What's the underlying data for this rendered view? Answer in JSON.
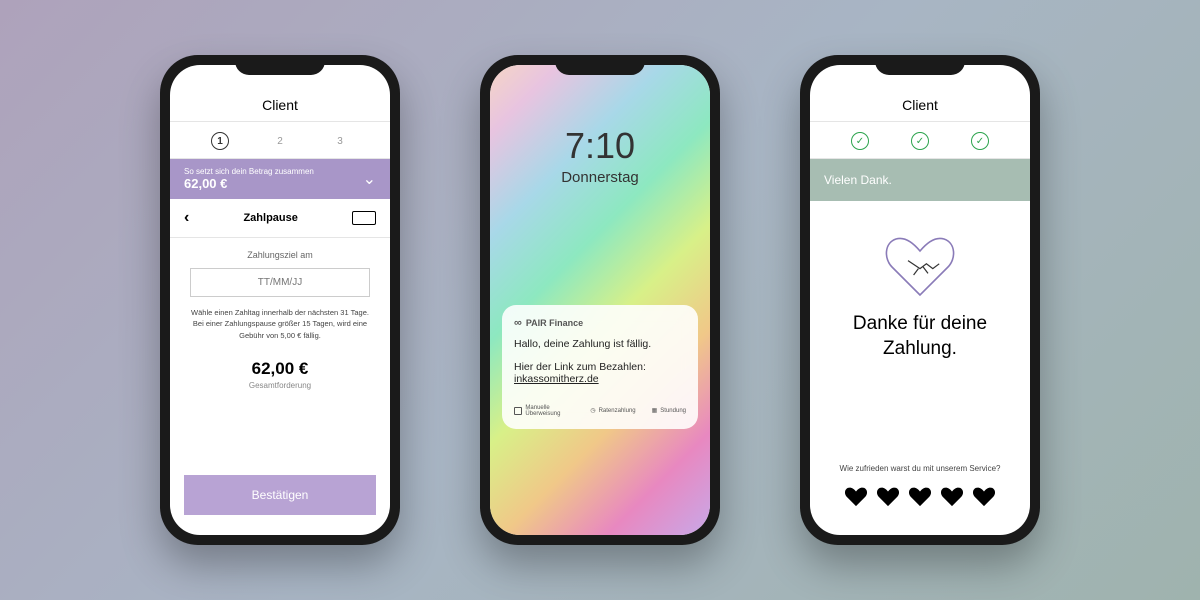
{
  "phone1": {
    "title": "Client",
    "steps": [
      "1",
      "2",
      "3"
    ],
    "amountBand": {
      "label": "So setzt sich dein Betrag zusammen",
      "amount": "62,00 €"
    },
    "zahlpause": "Zahlpause",
    "dateLabel": "Zahlungsziel am",
    "datePlaceholder": "TT/MM/JJ",
    "helpText": "Wähle einen Zahltag innerhalb der nächsten 31 Tage. Bei einer Zahlungspause größer 15 Tagen, wird eine Gebühr von 5,00 € fällig.",
    "total": "62,00 €",
    "totalLabel": "Gesamtforderung",
    "confirm": "Bestätigen"
  },
  "phone2": {
    "time": "7:10",
    "day": "Donnerstag",
    "notifSender": "PAIR Finance",
    "notifGreeting": "Hallo, deine Zahlung ist fällig.",
    "notifLinkLabel": "Hier der Link zum Bezahlen:",
    "notifLink": "inkassomitherz.de",
    "pills": [
      "Manuelle Überweisung",
      "Ratenzahlung",
      "Stundung"
    ]
  },
  "phone3": {
    "title": "Client",
    "thanksBand": "Vielen Dank.",
    "message": "Danke für deine Zahlung.",
    "survey": "Wie zufrieden warst du mit unserem Service?"
  }
}
